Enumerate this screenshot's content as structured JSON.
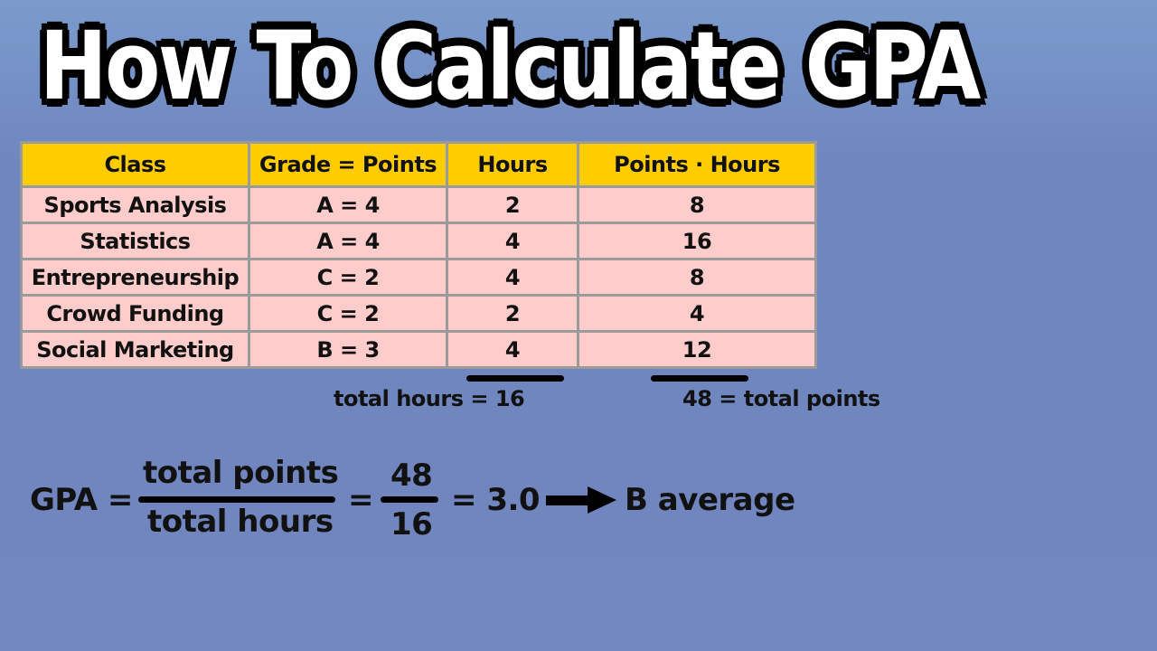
{
  "title": "How To Calculate GPA",
  "table": {
    "headers": [
      "Class",
      "Grade = Points",
      "Hours",
      "Points · Hours"
    ],
    "rows": [
      [
        "Sports Analysis",
        "A = 4",
        "2",
        "8"
      ],
      [
        "Statistics",
        "A = 4",
        "4",
        "16"
      ],
      [
        "Entrepreneurship",
        "C = 2",
        "4",
        "8"
      ],
      [
        "Crowd Funding",
        "C = 2",
        "2",
        "4"
      ],
      [
        "Social Marketing",
        "B = 3",
        "4",
        "12"
      ]
    ]
  },
  "totals": {
    "hours_label": "total hours = 16",
    "points_label": "48 = total points"
  },
  "formula": {
    "lhs": "GPA =",
    "numerator": "total points",
    "denominator": "total hours",
    "eq2": "=",
    "num_value": "48",
    "den_value": "16",
    "result": "= 3.0",
    "arrow_icon": "right-arrow-icon",
    "conclusion": "B average"
  },
  "colors": {
    "background": "#7286bf",
    "header_fill": "#ffcc00",
    "row_fill": "#ffcccc",
    "grid": "#9a9a9a"
  }
}
